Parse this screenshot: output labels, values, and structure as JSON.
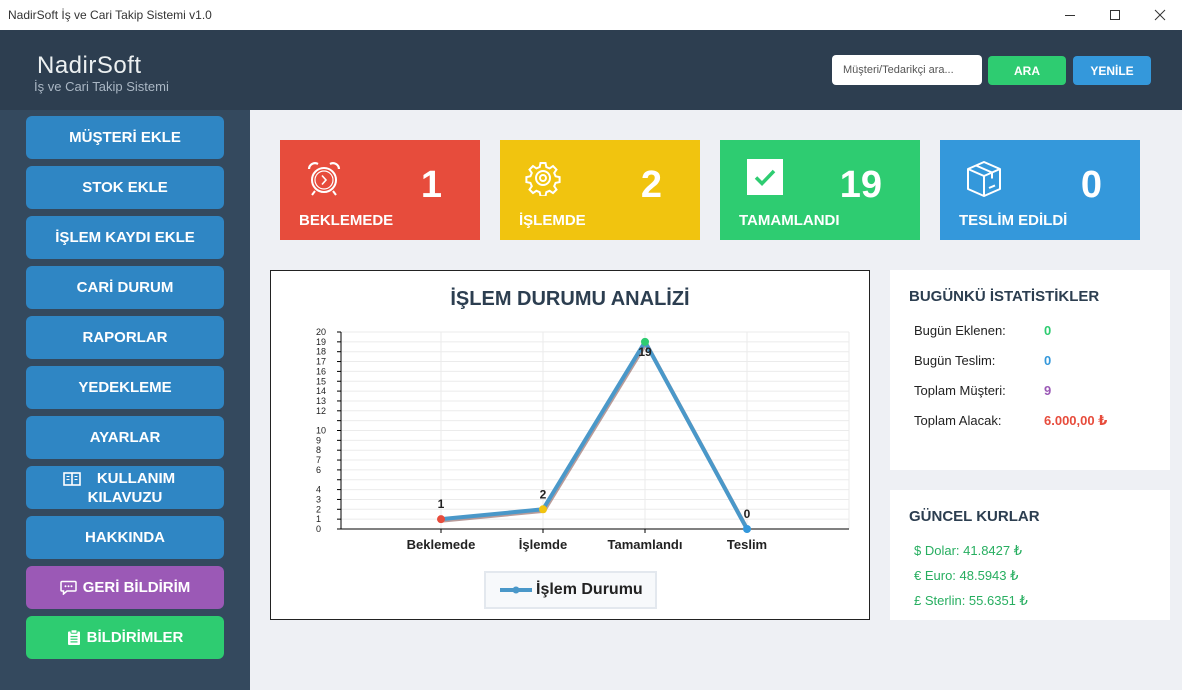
{
  "window": {
    "title": "NadirSoft İş ve Cari Takip Sistemi v1.0"
  },
  "header": {
    "brand": "NadirSoft",
    "subtitle": "İş ve Cari Takip Sistemi",
    "search_placeholder": "Müşteri/Tedarikçi ara...",
    "search_button": "ARA",
    "refresh_button": "YENİLE"
  },
  "sidebar": {
    "items": [
      {
        "label": "MÜŞTERİ EKLE"
      },
      {
        "label": "STOK EKLE"
      },
      {
        "label": "İŞLEM KAYDI EKLE"
      },
      {
        "label": "CARİ DURUM"
      },
      {
        "label": "RAPORLAR"
      },
      {
        "label": "YEDEKLEME"
      },
      {
        "label": "AYARLAR"
      },
      {
        "label": "KULLANIM KILAVUZU"
      },
      {
        "label": "HAKKINDA"
      },
      {
        "label": "GERİ BİLDİRİM"
      },
      {
        "label": "BİLDİRİMLER"
      }
    ]
  },
  "cards": [
    {
      "label": "BEKLEMEDE",
      "value": "1",
      "color": "#e74c3c",
      "icon": "alarm-clock-icon"
    },
    {
      "label": "İŞLEMDE",
      "value": "2",
      "color": "#f1c40f",
      "icon": "gear-icon"
    },
    {
      "label": "TAMAMLANDI",
      "value": "19",
      "color": "#2ecc71",
      "icon": "checkbox-icon"
    },
    {
      "label": "TESLİM EDİLDİ",
      "value": "0",
      "color": "#3498db",
      "icon": "box-icon"
    }
  ],
  "chart_data": {
    "type": "line",
    "title": "İŞLEM DURUMU ANALİZİ",
    "categories": [
      "Beklemede",
      "İşlemde",
      "Tamamlandı",
      "Teslim"
    ],
    "series": [
      {
        "name": "İşlem Durumu",
        "values": [
          1,
          2,
          19,
          0
        ],
        "color": "#4a98c9"
      }
    ],
    "point_colors": [
      "#e74c3c",
      "#f1c40f",
      "#2ecc71",
      "#3498db"
    ],
    "ylim": [
      0,
      20
    ],
    "yticks": [
      0,
      1,
      2,
      3,
      4,
      5,
      6,
      7,
      8,
      9,
      10,
      11,
      12,
      13,
      14,
      15,
      16,
      17,
      18,
      19,
      20
    ],
    "yticks_shown": [
      "0",
      "1",
      "2",
      "3",
      "4",
      "6",
      "7",
      "8",
      "9",
      "10",
      "12",
      "13",
      "14",
      "15",
      "16",
      "17",
      "18",
      "19",
      "20"
    ],
    "data_labels": [
      "1",
      "2",
      "19",
      "0"
    ],
    "grid": true,
    "legend": "bottom"
  },
  "today_stats": {
    "title": "BUGÜNKÜ İSTATİSTİKLER",
    "rows": [
      {
        "label": "Bugün Eklenen:",
        "value": "0",
        "color": "#2ecc71"
      },
      {
        "label": "Bugün Teslim:",
        "value": "0",
        "color": "#3498db"
      },
      {
        "label": "Toplam Müşteri:",
        "value": "9",
        "color": "#9b59b6"
      },
      {
        "label": "Toplam Alacak:",
        "value": "6.000,00 ₺",
        "color": "#e74c3c"
      }
    ]
  },
  "rates": {
    "title": "GÜNCEL KURLAR",
    "rows": [
      {
        "text": "$ Dolar: 41.8427 ₺"
      },
      {
        "text": "€ Euro: 48.5943 ₺"
      },
      {
        "text": "£ Sterlin: 55.6351 ₺"
      }
    ]
  }
}
